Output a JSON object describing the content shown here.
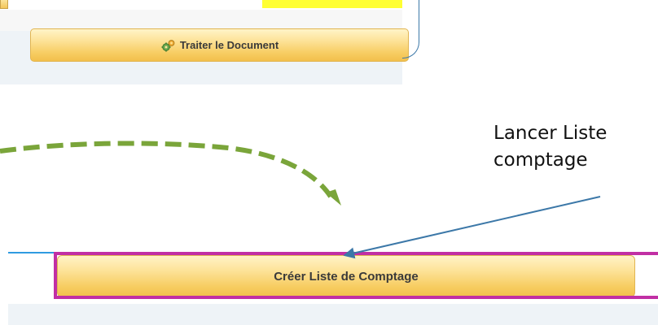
{
  "top_screenshot": {
    "process_button_label": "Traiter le Document",
    "process_icon": "gears-icon",
    "field_highlight_color": "#ffff33"
  },
  "annotation": {
    "line1": "Lancer Liste",
    "line2": "comptage"
  },
  "bottom_screenshot": {
    "create_button_label": "Créer Liste de Comptage"
  },
  "colors": {
    "button_gradient_top": "#fff4c8",
    "button_gradient_bottom": "#f2c04c",
    "highlight_border": "#c12fa4",
    "dashed_arrow": "#7aa53a",
    "callout_arrow": "#3c78a8"
  }
}
